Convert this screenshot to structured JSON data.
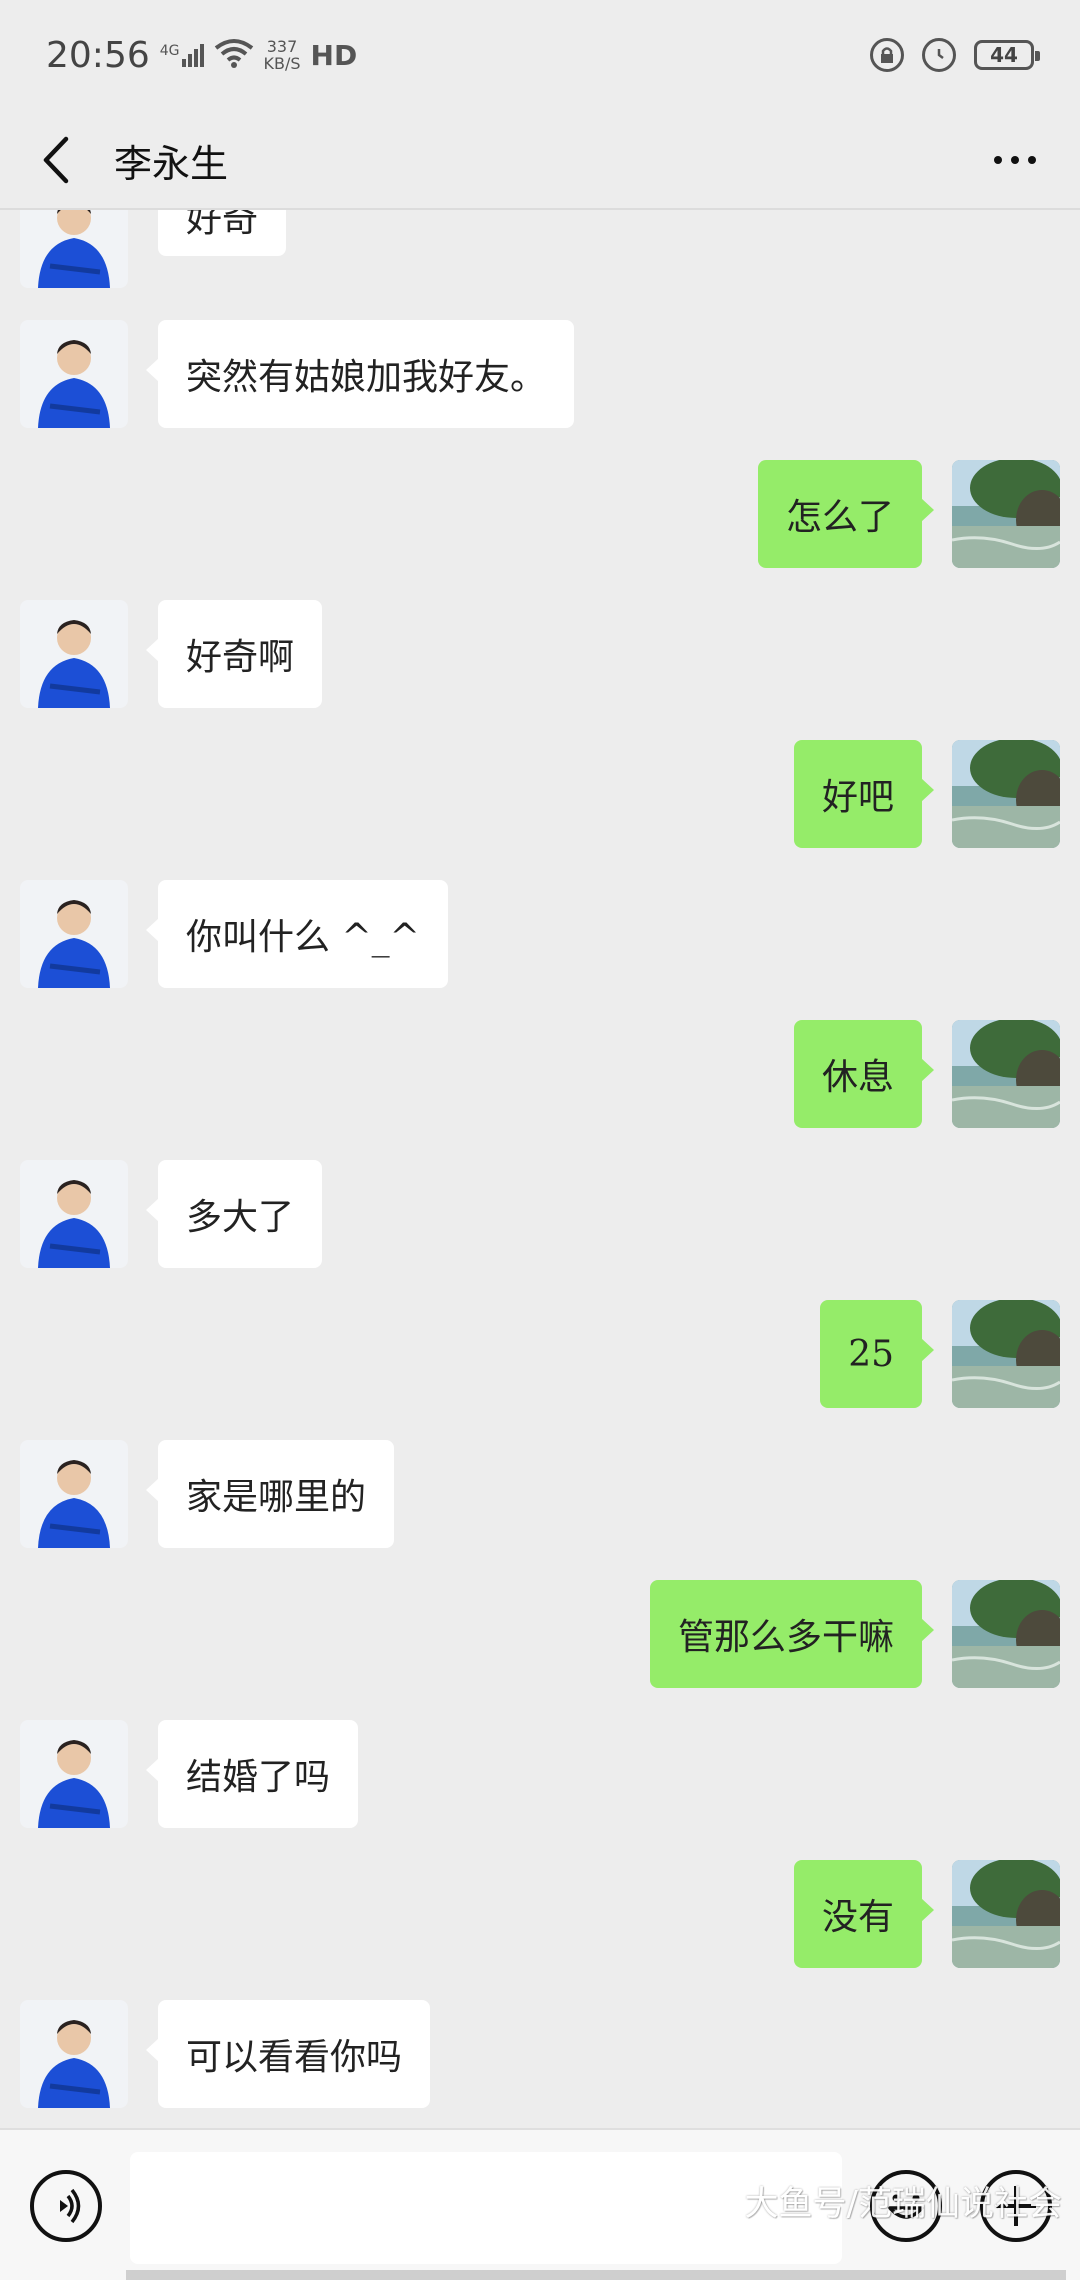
{
  "status_bar": {
    "time": "20:56",
    "network_type": "4G",
    "speed_value": "337",
    "speed_unit": "KB/S",
    "hd_label": "HD",
    "battery_level": "44",
    "icons": [
      "signal-icon",
      "wifi-icon",
      "lock-rotation-icon",
      "alarm-icon",
      "battery-icon"
    ]
  },
  "header": {
    "contact_name": "李永生",
    "back_icon": "chevron-left-icon",
    "more_icon": "more-dots-icon"
  },
  "messages": [
    {
      "side": "left",
      "text": "好奇"
    },
    {
      "side": "left",
      "text": "突然有姑娘加我好友。"
    },
    {
      "side": "right",
      "text": "怎么了"
    },
    {
      "side": "left",
      "text": "好奇啊"
    },
    {
      "side": "right",
      "text": "好吧"
    },
    {
      "side": "left",
      "text": "你叫什么 ^_^"
    },
    {
      "side": "right",
      "text": "休息"
    },
    {
      "side": "left",
      "text": "多大了"
    },
    {
      "side": "right",
      "text": "25"
    },
    {
      "side": "left",
      "text": "家是哪里的"
    },
    {
      "side": "right",
      "text": "管那么多干嘛"
    },
    {
      "side": "left",
      "text": "结婚了吗"
    },
    {
      "side": "right",
      "text": "没有"
    },
    {
      "side": "left",
      "text": "可以看看你吗"
    }
  ],
  "input_bar": {
    "message_value": "",
    "icons": [
      "voice-icon",
      "emoji-icon",
      "plus-icon"
    ]
  },
  "watermark": "大鱼号/范瑞仙说社会",
  "colors": {
    "background": "#EDEDED",
    "sent_bubble": "#95EC69",
    "received_bubble": "#FFFFFF",
    "contact_avatar": "#1C4FD6"
  }
}
